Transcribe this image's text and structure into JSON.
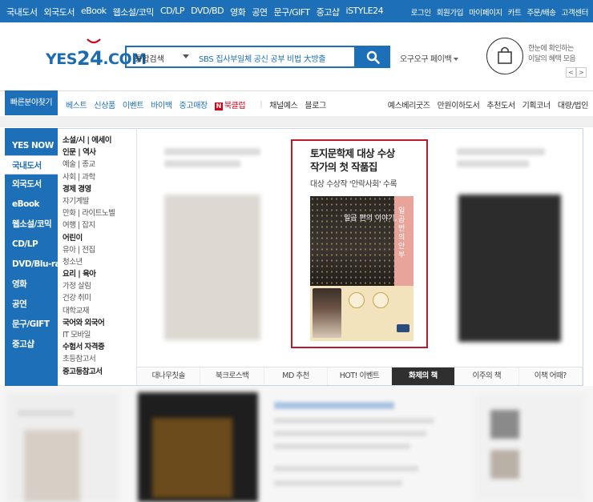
{
  "topbar": {
    "left_items": [
      "국내도서",
      "외국도서",
      "eBook",
      "웹소설/코믹",
      "CD/LP",
      "DVD/BD",
      "영화",
      "공연",
      "문구/GIFT",
      "중고샵",
      "iSTYLE24"
    ],
    "right_items": [
      "로그인",
      "회원가입",
      "마이페이지",
      "카트",
      "주문/배송",
      "고객센터"
    ]
  },
  "header": {
    "logo_text": "YES",
    "logo_num": "24",
    "logo_suffix": ".COM",
    "search_category": "통합검색",
    "search_query": "SBS 집사부일체 공신 공부 비법 大방출",
    "user_label": "오구오구 페이백",
    "promo_line1": "한눈에 확인하는",
    "promo_line2": "이달의 혜택 모음",
    "prev_arrow": "<",
    "next_arrow": ">"
  },
  "nav": {
    "quick_label": "빠른분야찾기",
    "left_items": [
      "베스트",
      "신상품",
      "이벤트",
      "바이백",
      "중고매장"
    ],
    "bookclub": "북클럽",
    "bookclub_badge": "N",
    "after_sep": [
      "채널예스",
      "블로그"
    ],
    "right_items": [
      "예스베리굿즈",
      "만원이하도서",
      "추천도서",
      "기획코너",
      "대량/법인"
    ]
  },
  "left_menu": {
    "items": [
      "YES NOW",
      "국내도서",
      "외국도서",
      "eBook",
      "웹소설/코믹",
      "CD/LP",
      "DVD/Blu-ray",
      "영화",
      "공연",
      "문구/GIFT",
      "중고샵"
    ],
    "active_index": 1
  },
  "submenu": {
    "rows": [
      {
        "text": "소설/시 | 에세이",
        "bold": true
      },
      {
        "text": "인문 | 역사",
        "bold": true
      },
      {
        "text": "예술 | 종교",
        "bold": false
      },
      {
        "text": "사회 | 과학",
        "bold": false
      },
      {
        "text": "경제 경영",
        "bold": true
      },
      {
        "text": "자기계발",
        "bold": false
      },
      {
        "text": "만화 | 라이트노벨",
        "bold": false
      },
      {
        "text": "여행 | 잡지",
        "bold": false
      },
      {
        "text": "어린이",
        "bold": true
      },
      {
        "text": "유아 | 전집",
        "bold": false
      },
      {
        "text": "청소년",
        "bold": false
      },
      {
        "text": "요리 | 육아",
        "bold": true
      },
      {
        "text": "가정 살림",
        "bold": false
      },
      {
        "text": "건강 취미",
        "bold": false
      },
      {
        "text": "대학교재",
        "bold": false
      },
      {
        "text": "국어와 외국어",
        "bold": true
      },
      {
        "text": "IT 모바일",
        "bold": false
      },
      {
        "text": "수험서 자격증",
        "bold": true
      },
      {
        "text": "초등참고서",
        "bold": false
      },
      {
        "text": "중고등참고서",
        "bold": true
      }
    ]
  },
  "feature": {
    "title_line1": "토지문학제 대상 수상",
    "title_line2": "작가의 첫 작품집",
    "subtitle": "대상 수상작 '안락사회' 수록",
    "cover_title": "일곱 편의 이야기,",
    "cover_vertical": "일곱번의안부"
  },
  "tabs": {
    "items": [
      "대나무칫솔",
      "북크로스백",
      "MD 추천",
      "HOT! 이벤트",
      "화제의 책",
      "이주의 책",
      "이책 어때?"
    ],
    "active_index": 4
  },
  "colors": {
    "brand_blue": "#1d6fb8",
    "feature_border": "#b71c2b",
    "active_tab": "#2f2f2f"
  }
}
